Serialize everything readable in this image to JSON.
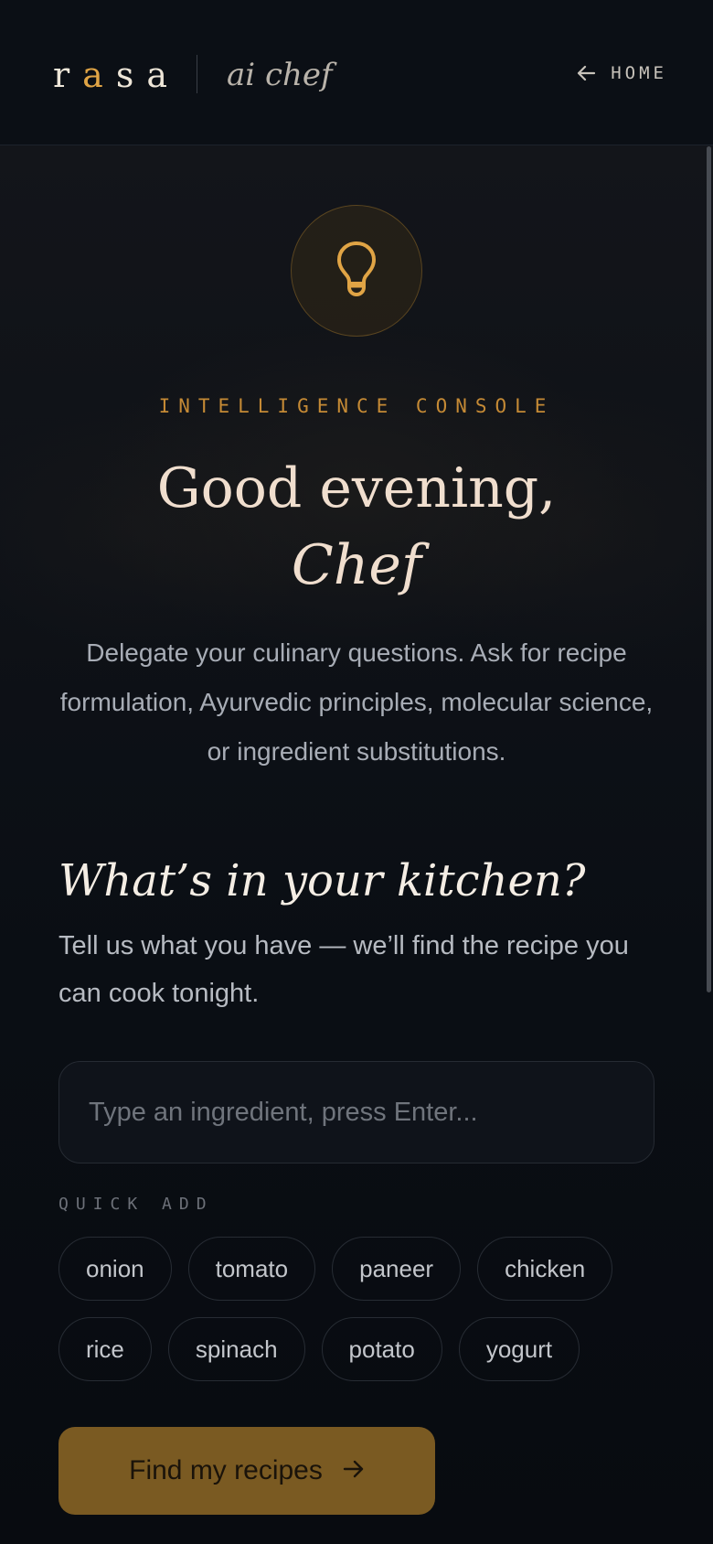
{
  "header": {
    "logo_letters": [
      "r",
      "a",
      "s",
      "a"
    ],
    "logo_sub": "ai chef",
    "home_label": "HOME",
    "home_icon": "arrow-left-icon"
  },
  "hero": {
    "icon": "lightbulb-icon",
    "eyebrow": "INTELLIGENCE CONSOLE",
    "greeting_line1": "Good evening,",
    "greeting_line2": "Chef",
    "intro": "Delegate your culinary questions. Ask for recipe formulation, Ayurvedic principles, molecular science, or ingredient substitutions."
  },
  "kitchen": {
    "title": "What’s in your kitchen?",
    "subtitle": "Tell us what you have — we’ll find the recipe you can cook tonight.",
    "input_placeholder": "Type an ingredient, press Enter...",
    "input_value": "",
    "quick_add_label": "QUICK ADD",
    "quick_add_row1": [
      "onion",
      "tomato",
      "paneer",
      "chicken"
    ],
    "quick_add_row2": [
      "rice",
      "spinach",
      "potato",
      "yogurt"
    ],
    "submit_label": "Find my recipes",
    "submit_icon": "arrow-right-icon"
  },
  "colors": {
    "background": "#0a0e14",
    "accent": "#e0a445",
    "eyebrow": "#c58a35",
    "button": "#7a5a22",
    "heading": "#f0dece"
  }
}
